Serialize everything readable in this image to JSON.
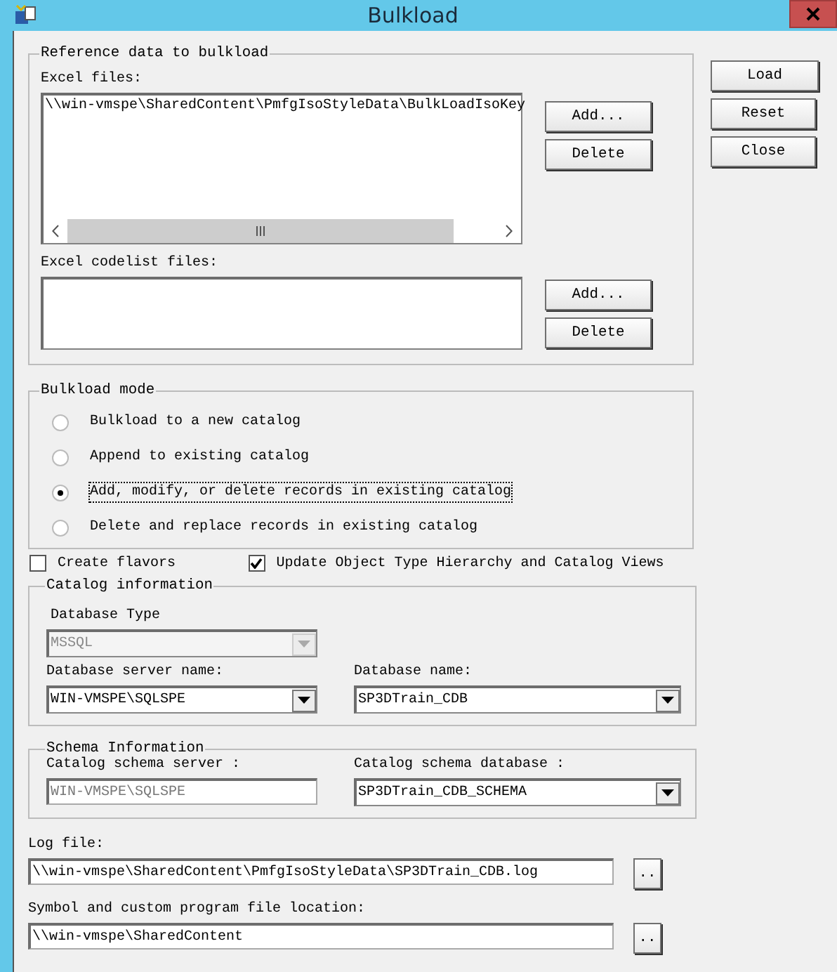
{
  "window": {
    "title": "Bulkload"
  },
  "side_buttons": [
    "Load",
    "Reset",
    "Close"
  ],
  "reference_group": {
    "title": "Reference data to bulkload",
    "excel_files": {
      "label": "Excel files:",
      "items": [
        "\\\\win-vmspe\\SharedContent\\PmfgIsoStyleData\\BulkLoadIsoKey"
      ],
      "buttons": [
        "Add...",
        "Delete"
      ]
    },
    "codelist_files": {
      "label": "Excel codelist files:",
      "buttons": [
        "Add...",
        "Delete"
      ]
    }
  },
  "mode_group": {
    "title": "Bulkload mode",
    "options": [
      {
        "label": "Bulkload to a new catalog",
        "selected": false
      },
      {
        "label": "Append to existing  catalog",
        "selected": false
      },
      {
        "label": "Add, modify, or delete records in existing catalog",
        "selected": true
      },
      {
        "label": "Delete and replace records in existing catalog",
        "selected": false
      }
    ]
  },
  "checkboxes": [
    {
      "label": "Create flavors",
      "checked": false
    },
    {
      "label": "Update Object Type Hierarchy and Catalog Views",
      "checked": true
    }
  ],
  "catalog_group": {
    "title": "Catalog information",
    "database_type": {
      "label": "Database Type",
      "value": "MSSQL",
      "disabled": true
    },
    "server": {
      "label": "Database server name:",
      "value": "WIN-VMSPE\\SQLSPE",
      "disabled": false
    },
    "database": {
      "label": "Database name:",
      "value": "SP3DTrain_CDB",
      "disabled": false
    }
  },
  "schema_group": {
    "title": "Schema Information",
    "schema_server": {
      "label": "Catalog schema server :",
      "value": "WIN-VMSPE\\SQLSPE",
      "disabled": true
    },
    "schema_database": {
      "label": "Catalog schema database :",
      "value": "SP3DTrain_CDB_SCHEMA",
      "disabled": false
    }
  },
  "log_file": {
    "label": "Log file:",
    "value": "\\\\win-vmspe\\SharedContent\\PmfgIsoStyleData\\SP3DTrain_CDB.log",
    "button": ".."
  },
  "symbol_location": {
    "label": "Symbol and custom program file location:",
    "value": "\\\\win-vmspe\\SharedContent",
    "button": ".."
  }
}
